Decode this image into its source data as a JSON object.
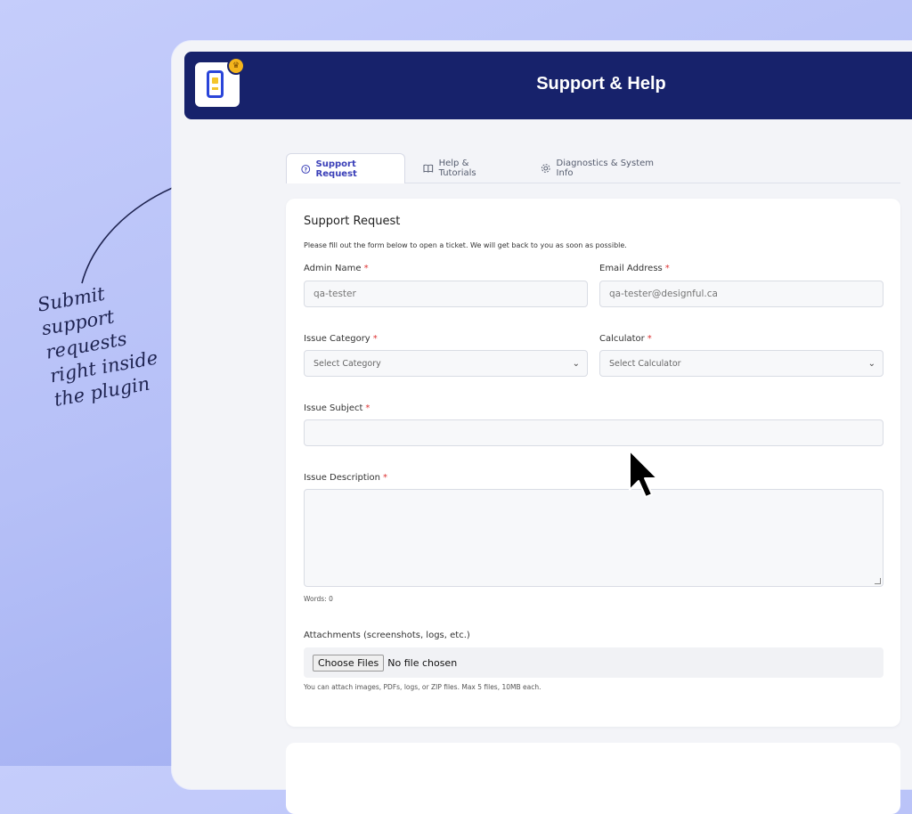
{
  "annotation": {
    "lines": [
      "Submit",
      "support",
      "requests",
      "right inside",
      "the plugin"
    ]
  },
  "header": {
    "title": "Support & Help"
  },
  "tabs": [
    {
      "label": "Support Request",
      "icon": "question-circle-icon",
      "active": true
    },
    {
      "label": "Help & Tutorials",
      "icon": "book-icon",
      "active": false
    },
    {
      "label": "Diagnostics & System Info",
      "icon": "gear-icon",
      "active": false
    }
  ],
  "form": {
    "title": "Support Request",
    "description": "Please fill out the form below to open a ticket. We will get back to you as soon as possible.",
    "required_marker": "*",
    "admin_name": {
      "label": "Admin Name",
      "placeholder": "qa-tester"
    },
    "email": {
      "label": "Email Address",
      "placeholder": "qa-tester@designful.ca"
    },
    "issue_category": {
      "label": "Issue Category",
      "selected": "Select Category"
    },
    "calculator": {
      "label": "Calculator",
      "selected": "Select Calculator"
    },
    "issue_subject": {
      "label": "Issue Subject",
      "value": ""
    },
    "issue_description": {
      "label": "Issue Description",
      "value": "",
      "word_count": "Words: 0"
    },
    "attachments": {
      "label": "Attachments (screenshots, logs, etc.)",
      "button": "Choose Files",
      "status": "No file chosen",
      "help": "You can attach images, PDFs, logs, or ZIP files. Max 5 files, 10MB each."
    }
  },
  "colors": {
    "header_bg": "#17226b",
    "accent": "#3a3fb8",
    "required": "#d33333"
  }
}
